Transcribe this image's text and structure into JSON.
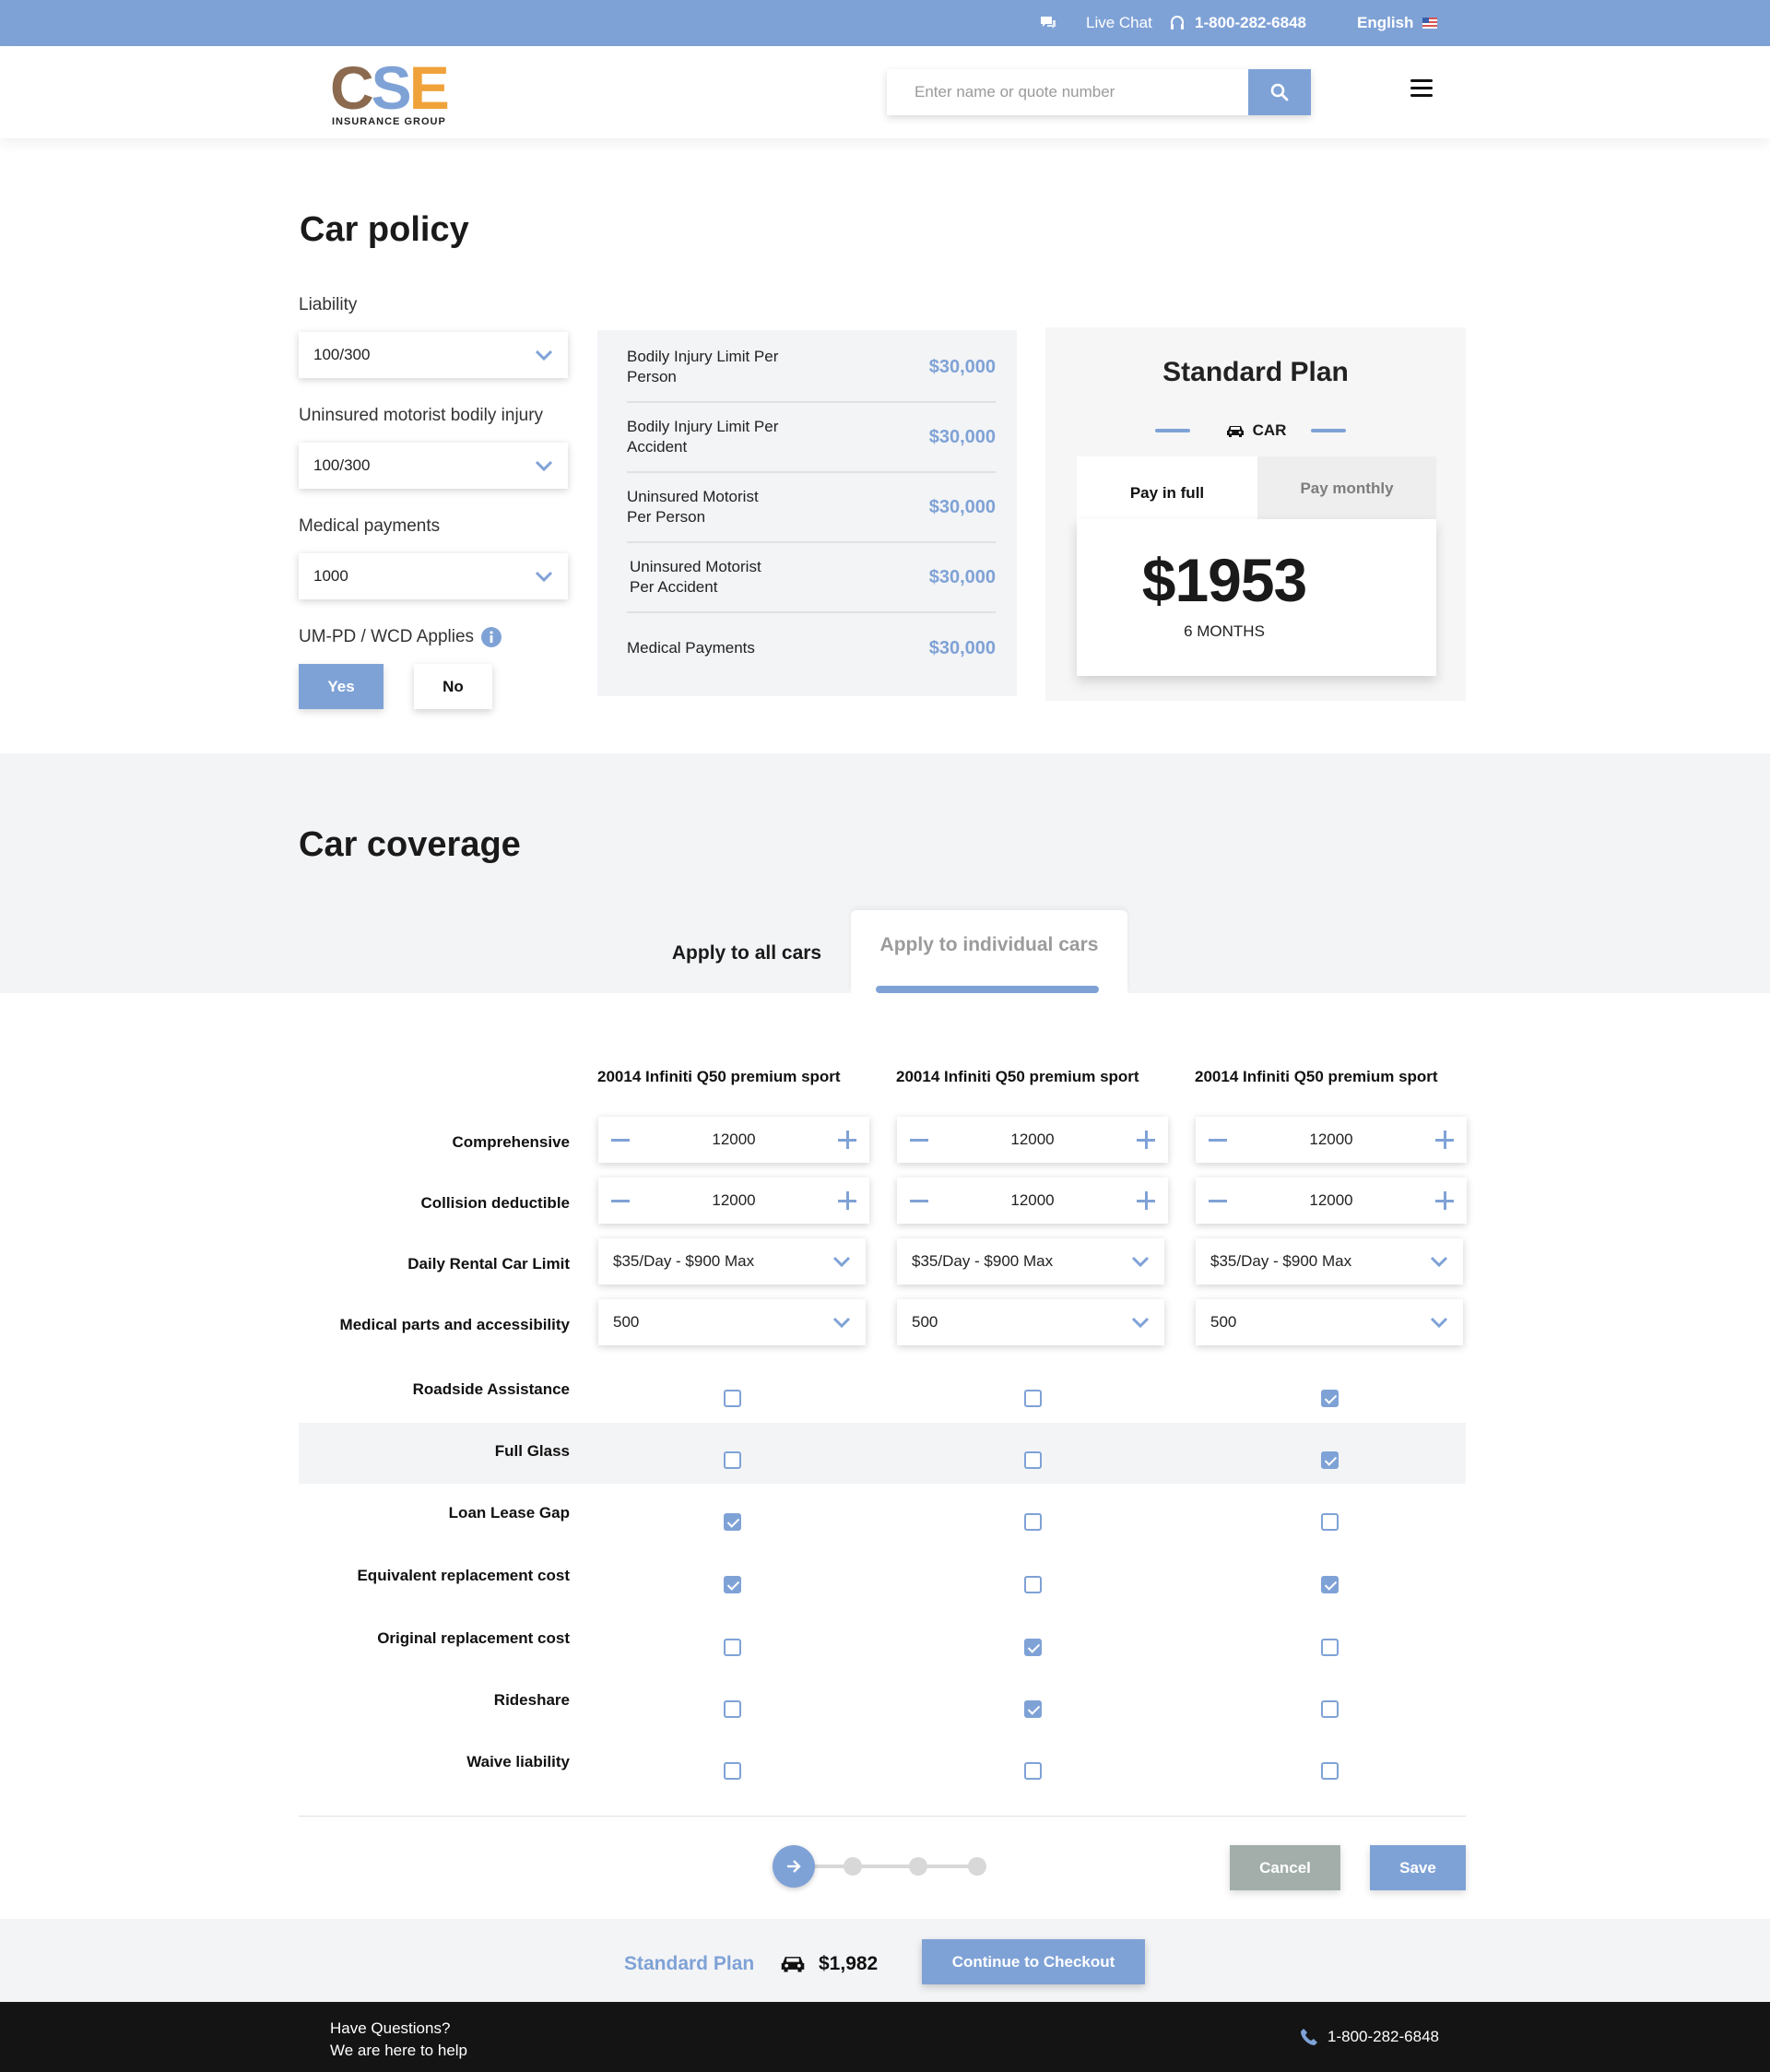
{
  "topbar": {
    "live_chat": "Live Chat",
    "phone": "1-800-282-6848",
    "language": "English"
  },
  "header": {
    "logo_letters": [
      "C",
      "S",
      "E"
    ],
    "logo_colors": [
      "#8b6a4f",
      "#7fa2d6",
      "#f0a23a"
    ],
    "logo_tagline": "INSURANCE GROUP",
    "search_placeholder": "Enter name or quote number"
  },
  "policy": {
    "title": "Car policy",
    "liability_label": "Liability",
    "liability_value": "100/300",
    "uninsured_label": "Uninsured motorist bodily injury",
    "uninsured_value": "100/300",
    "medical_label": "Medical payments",
    "medical_value": "1000",
    "umpd_label": "UM-PD / WCD Applies",
    "yes_label": "Yes",
    "no_label": "No",
    "limits": [
      {
        "name": "Bodily Injury Limit Per Person",
        "value": "$30,000"
      },
      {
        "name": "Bodily Injury Limit Per Accident",
        "value": "$30,000"
      },
      {
        "name": "Uninsured Motorist Per Person",
        "value": "$30,000"
      },
      {
        "name": "Uninsured Motorist Per Accident",
        "value": "$30,000"
      },
      {
        "name": "Medical Payments",
        "value": "$30,000"
      }
    ]
  },
  "plan": {
    "title": "Standard Plan",
    "vehicle": "CAR",
    "tab_full": "Pay in full",
    "tab_monthly": "Pay monthly",
    "price": "$1953",
    "term": "6 MONTHS"
  },
  "coverage": {
    "title": "Car coverage",
    "tab_all": "Apply to all cars",
    "tab_individual": "Apply to individual cars",
    "cars": [
      "20014 Infiniti Q50 premium sport",
      "20014 Infiniti Q50 premium sport",
      "20014 Infiniti Q50 premium sport"
    ],
    "rows": {
      "comprehensive": "Comprehensive",
      "collision": "Collision deductible",
      "rental": "Daily Rental Car Limit",
      "medical_parts": "Medical parts and accessibility"
    },
    "comprehensive_values": [
      "12000",
      "12000",
      "12000"
    ],
    "collision_values": [
      "12000",
      "12000",
      "12000"
    ],
    "rental_values": [
      "$35/Day - $900 Max",
      "$35/Day - $900 Max",
      "$35/Day - $900 Max"
    ],
    "medical_parts_values": [
      "500",
      "500",
      "500"
    ],
    "checkbox_rows": [
      {
        "label": "Roadside Assistance",
        "checked": [
          false,
          false,
          true
        ]
      },
      {
        "label": "Full Glass",
        "checked": [
          false,
          false,
          true
        ]
      },
      {
        "label": "Loan Lease Gap",
        "checked": [
          true,
          false,
          false
        ]
      },
      {
        "label": "Equivalent replacement cost",
        "checked": [
          true,
          false,
          true
        ]
      },
      {
        "label": "Original replacement cost",
        "checked": [
          false,
          true,
          false
        ]
      },
      {
        "label": "Rideshare",
        "checked": [
          false,
          true,
          false
        ]
      },
      {
        "label": "Waive liability",
        "checked": [
          false,
          false,
          false
        ]
      }
    ],
    "cancel_label": "Cancel",
    "save_label": "Save"
  },
  "summary": {
    "plan": "Standard Plan",
    "price": "$1,982",
    "checkout_label": "Continue to Checkout"
  },
  "footer": {
    "line1": "Have Questions?",
    "line2": "We are here to help",
    "phone": "1-800-282-6848"
  },
  "colors": {
    "accent": "#7fa2d6",
    "cancel": "#a3aeab",
    "footer_bg": "#141414"
  }
}
